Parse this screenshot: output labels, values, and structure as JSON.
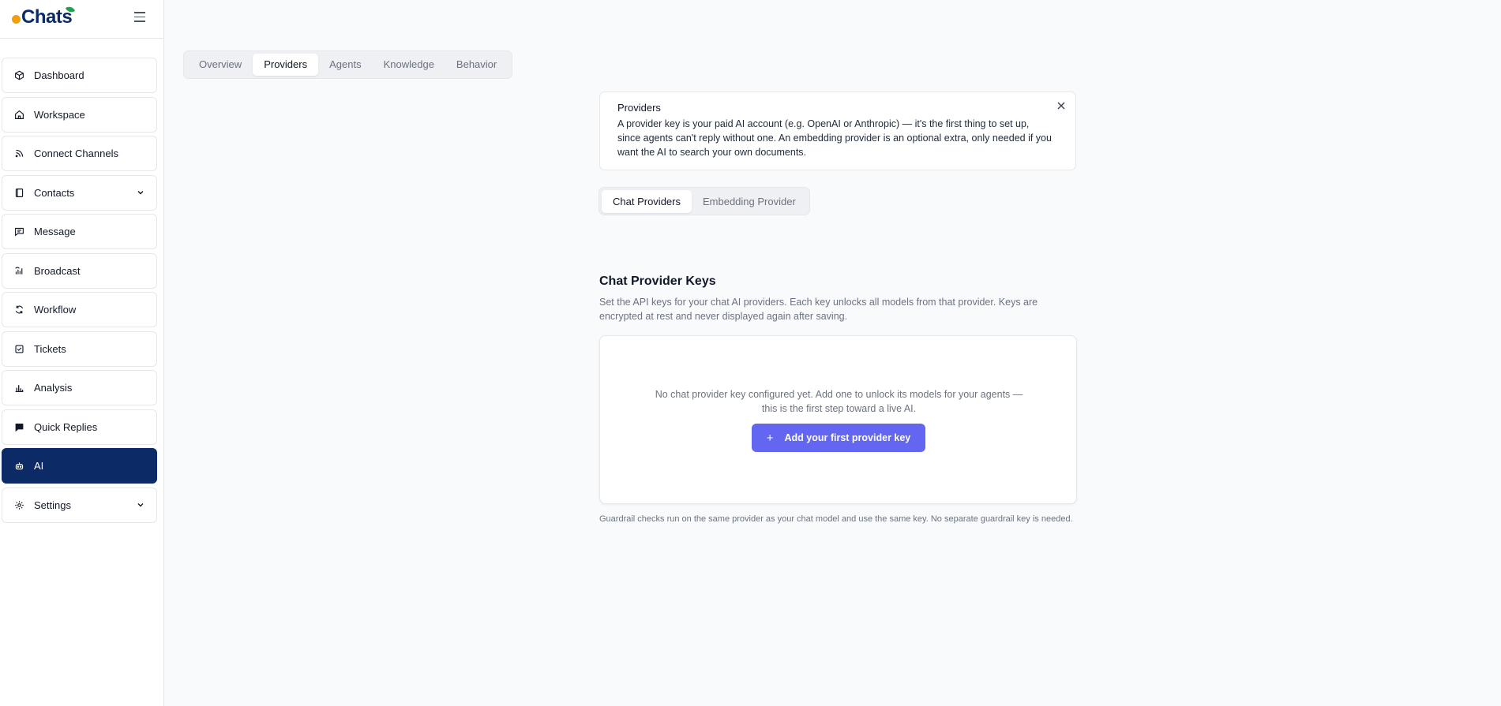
{
  "brand": {
    "name": "Chats"
  },
  "sidebar": {
    "items": [
      {
        "label": "Dashboard",
        "icon": "cube-icon"
      },
      {
        "label": "Workspace",
        "icon": "home-icon"
      },
      {
        "label": "Connect Channels",
        "icon": "rss-icon"
      },
      {
        "label": "Contacts",
        "icon": "book-icon"
      },
      {
        "label": "Message",
        "icon": "message-icon"
      },
      {
        "label": "Broadcast",
        "icon": "broadcast-icon"
      },
      {
        "label": "Workflow",
        "icon": "refresh-icon"
      },
      {
        "label": "Tickets",
        "icon": "checkbox-icon"
      },
      {
        "label": "Analysis",
        "icon": "bar-chart-icon"
      },
      {
        "label": "Quick Replies",
        "icon": "chat-bubble-icon"
      },
      {
        "label": "AI",
        "icon": "robot-icon"
      },
      {
        "label": "Settings",
        "icon": "gear-icon"
      }
    ]
  },
  "top_tabs": [
    "Overview",
    "Providers",
    "Agents",
    "Knowledge",
    "Behavior"
  ],
  "info": {
    "title": "Providers",
    "text": "A provider key is your paid AI account (e.g. OpenAI or Anthropic) — it's the first thing to set up, since agents can't reply without one. An embedding provider is an optional extra, only needed if you want the AI to search your own documents."
  },
  "sub_tabs": [
    "Chat Providers",
    "Embedding Provider"
  ],
  "section": {
    "title": "Chat Provider Keys",
    "description": "Set the API keys for your chat AI providers. Each key unlocks all models from that provider. Keys are encrypted at rest and never displayed again after saving."
  },
  "empty_state": {
    "text": "No chat provider key configured yet. Add one to unlock its models for your agents — this is the first step toward a live AI.",
    "button_label": "Add your first provider key"
  },
  "footnote": "Guardrail checks run on the same provider as your chat model and use the same key. No separate guardrail key is needed.",
  "colors": {
    "primary": "#0b2a66",
    "accent": "#6366f1"
  }
}
